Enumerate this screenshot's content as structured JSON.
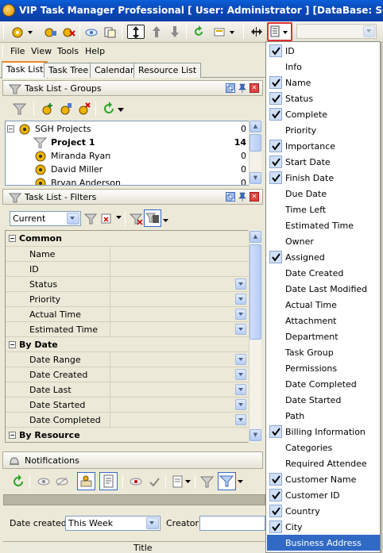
{
  "window": {
    "title": "VIP Task Manager Professional [ User: Administrator ] [DataBase: SGH Projects]"
  },
  "menu": {
    "items": [
      "File",
      "View",
      "Tools",
      "Help"
    ]
  },
  "tabs": [
    "Task List",
    "Task Tree",
    "Calendar",
    "Resource List"
  ],
  "groups_panel": {
    "title": "Task List - Groups",
    "rows": [
      {
        "label": "SGH Projects",
        "count": "0"
      },
      {
        "label": "Project 1",
        "count": "14"
      },
      {
        "label": "Miranda Ryan",
        "count": "0"
      },
      {
        "label": "David Miller",
        "count": "0"
      },
      {
        "label": "Bryan Anderson",
        "count": "0"
      }
    ]
  },
  "filters_panel": {
    "title": "Task List - Filters",
    "current_filter": "Current",
    "categories": [
      {
        "name": "Common",
        "rows": [
          "Name",
          "ID",
          "Status",
          "Priority",
          "Actual Time",
          "Estimated Time"
        ]
      },
      {
        "name": "By Date",
        "rows": [
          "Date Range",
          "Date Created",
          "Date Last Modified",
          "Date Started",
          "Date Completed"
        ]
      },
      {
        "name": "By Resource",
        "rows": []
      }
    ]
  },
  "notifications": {
    "title": "Notifications",
    "date_created_label": "Date created:",
    "date_created_value": "This Week",
    "creator_label": "Creator:",
    "column_title": "Title"
  },
  "column_menu": {
    "items": [
      {
        "label": "ID",
        "checked": true
      },
      {
        "label": "Info",
        "checked": false
      },
      {
        "label": "Name",
        "checked": true
      },
      {
        "label": "Status",
        "checked": true
      },
      {
        "label": "Complete",
        "checked": true
      },
      {
        "label": "Priority",
        "checked": false
      },
      {
        "label": "Importance",
        "checked": true
      },
      {
        "label": "Start Date",
        "checked": true
      },
      {
        "label": "Finish Date",
        "checked": true
      },
      {
        "label": "Due Date",
        "checked": false
      },
      {
        "label": "Time Left",
        "checked": false
      },
      {
        "label": "Estimated Time",
        "checked": false
      },
      {
        "label": "Owner",
        "checked": false
      },
      {
        "label": "Assigned",
        "checked": true
      },
      {
        "label": "Date Created",
        "checked": false
      },
      {
        "label": "Date Last Modified",
        "checked": false
      },
      {
        "label": "Actual Time",
        "checked": false
      },
      {
        "label": "Attachment",
        "checked": false
      },
      {
        "label": "Department",
        "checked": false
      },
      {
        "label": "Task Group",
        "checked": false
      },
      {
        "label": "Permissions",
        "checked": false
      },
      {
        "label": "Date Completed",
        "checked": false
      },
      {
        "label": "Date Started",
        "checked": false
      },
      {
        "label": "Path",
        "checked": false
      },
      {
        "label": "Billing Information",
        "checked": true
      },
      {
        "label": "Categories",
        "checked": false
      },
      {
        "label": "Required Attendee",
        "checked": false
      },
      {
        "label": "Customer Name",
        "checked": true
      },
      {
        "label": "Customer ID",
        "checked": true
      },
      {
        "label": "Country",
        "checked": true
      },
      {
        "label": "City",
        "checked": true
      },
      {
        "label": "Business Address",
        "checked": false
      }
    ],
    "selected": "Business Address"
  },
  "colors": {
    "accent": "#316ac5",
    "titlebar": "#0a5fd8",
    "tab_highlight": "#e68b2c",
    "close": "#e04343"
  }
}
